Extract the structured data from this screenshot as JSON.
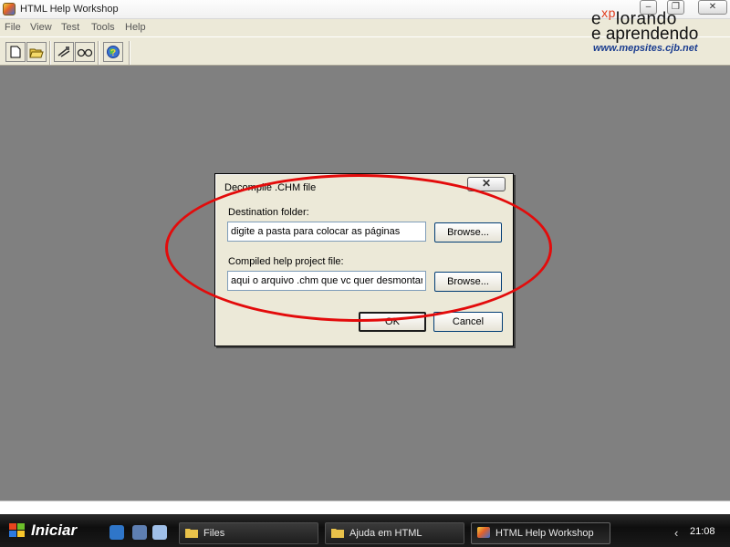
{
  "window": {
    "title": "HTML Help Workshop",
    "minimize_glyph": "–",
    "maximize_glyph": "❐",
    "close_glyph": "✕"
  },
  "menu": [
    "File",
    "View",
    "Test",
    "Tools",
    "Help"
  ],
  "toolbar": {
    "new_icon": "new-file-icon",
    "open_icon": "open-folder-icon",
    "compile_icon": "compile-icon",
    "view_icon": "view-glasses-icon",
    "help_icon": "help-globe-icon"
  },
  "logo": {
    "line1_a": "e",
    "line1_xp": "xp",
    "line1_b": "lorando",
    "line2": "e aprendendo",
    "url": "www.mepsites.cjb.net"
  },
  "dialog": {
    "title": "Decompile .CHM file",
    "close_glyph": "✕",
    "destination_label": "Destination folder:",
    "destination_value": "digite a pasta para colocar as páginas",
    "browse1": "Browse...",
    "compiled_label": "Compiled help project file:",
    "compiled_value": "aqui o arquivo .chm que vc quer desmontar",
    "browse2": "Browse...",
    "ok": "OK",
    "cancel": "Cancel"
  },
  "taskbar": {
    "start": "Iniciar",
    "tasks": [
      "Files",
      "Ajuda em HTML",
      "HTML Help Workshop"
    ],
    "tray_arrow": "‹",
    "clock": "21:08"
  },
  "colors": {
    "annotation": "#e30b0b",
    "workarea": "#808080",
    "dialog_face": "#ECE9D8"
  }
}
